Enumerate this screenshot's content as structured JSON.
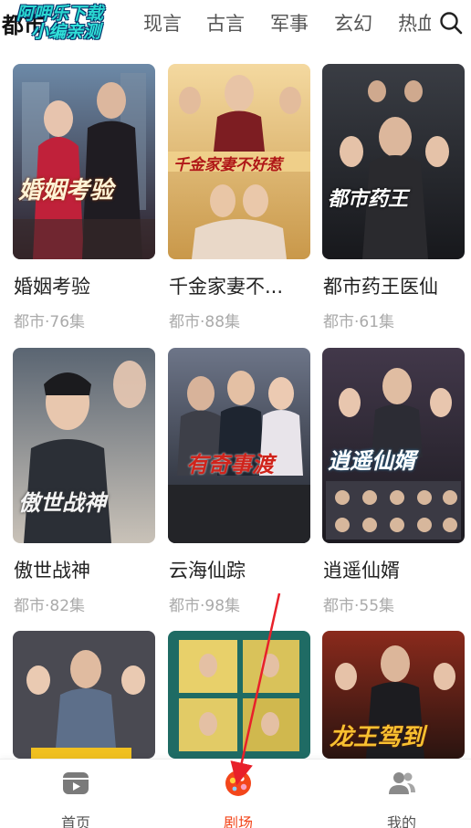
{
  "tabs": [
    {
      "label": "都市",
      "active": true
    },
    {
      "label": "现言",
      "active": false
    },
    {
      "label": "古言",
      "active": false
    },
    {
      "label": "军事",
      "active": false
    },
    {
      "label": "玄幻",
      "active": false
    },
    {
      "label": "热血",
      "active": false
    }
  ],
  "watermark": {
    "line1": "阿呷乐下载",
    "line2": "小编亲测"
  },
  "colors": {
    "accent": "#f3461b",
    "watermark": "#2ad7d0",
    "meta": "#aaaaaa"
  },
  "dramas": [
    {
      "title": "婚姻考验",
      "meta": "都市·76集",
      "poster_text": "婚姻考验"
    },
    {
      "title": "千金家妻不...",
      "meta": "都市·88集",
      "poster_text": "千金家妻不好惹"
    },
    {
      "title": "都市药王医仙",
      "meta": "都市·61集",
      "poster_text": "都市药王"
    },
    {
      "title": "傲世战神",
      "meta": "都市·82集",
      "poster_text": "傲世战神"
    },
    {
      "title": "云海仙踪",
      "meta": "都市·98集",
      "poster_text": "有奇事渡"
    },
    {
      "title": "逍遥仙婿",
      "meta": "都市·55集",
      "poster_text": "逍遥仙婿"
    },
    {
      "title": "",
      "meta": "",
      "poster_text": ""
    },
    {
      "title": "",
      "meta": "",
      "poster_text": ""
    },
    {
      "title": "",
      "meta": "",
      "poster_text": "龙王驾到"
    }
  ],
  "nav": [
    {
      "label": "首页",
      "icon": "play-card-icon",
      "active": false
    },
    {
      "label": "剧场",
      "icon": "theater-icon",
      "active": true
    },
    {
      "label": "我的",
      "icon": "users-icon",
      "active": false
    }
  ]
}
